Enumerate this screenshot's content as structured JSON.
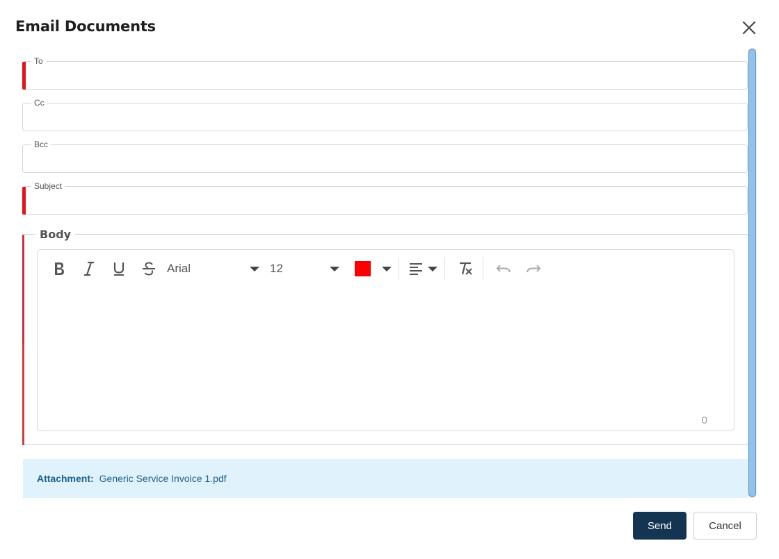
{
  "dialog": {
    "title": "Email Documents",
    "close_icon": "close-icon"
  },
  "fields": {
    "to": {
      "label": "To",
      "value": "",
      "required": true
    },
    "cc": {
      "label": "Cc",
      "value": "",
      "required": false
    },
    "bcc": {
      "label": "Bcc",
      "value": "",
      "required": false
    },
    "subject": {
      "label": "Subject",
      "value": "",
      "required": true
    }
  },
  "body": {
    "label": "Body",
    "toolbar": {
      "bold_icon": "bold-icon",
      "italic_icon": "italic-icon",
      "underline_icon": "underline-icon",
      "strikethrough_icon": "strikethrough-icon",
      "font_family": "Arial",
      "font_size": "12",
      "text_color": "#ff0000",
      "align_icon": "align-left-icon",
      "clear_format_icon": "clear-format-icon",
      "undo_icon": "undo-icon",
      "redo_icon": "redo-icon"
    },
    "content": "",
    "char_count": "0"
  },
  "attachment": {
    "label": "Attachment:",
    "file_name": "Generic Service Invoice 1.pdf"
  },
  "actions": {
    "send_label": "Send",
    "cancel_label": "Cancel"
  },
  "colors": {
    "required_accent": "#e3141b",
    "primary_button": "#143551",
    "attachment_bg": "#e0f3fc",
    "attachment_text": "#1d5f8a",
    "scrollbar_thumb": "#8ec3f0"
  }
}
